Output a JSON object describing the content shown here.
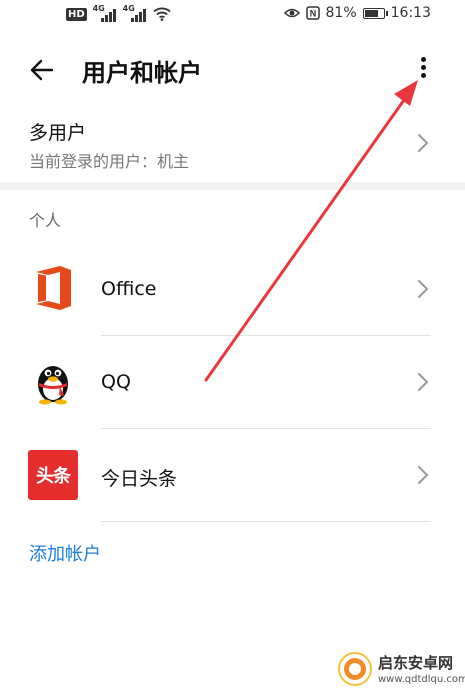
{
  "status_bar": {
    "hd_label": "HD",
    "network_1": "4G",
    "network_2": "4G",
    "nfc_label": "N",
    "battery_percent": "81%",
    "battery_level": 0.81,
    "time": "16:13"
  },
  "header": {
    "title": "用户和帐户"
  },
  "multi_user": {
    "title": "多用户",
    "subtitle": "当前登录的用户：机主"
  },
  "personal_section": {
    "label": "个人",
    "accounts": [
      {
        "name": "Office",
        "icon": "office-icon"
      },
      {
        "name": "QQ",
        "icon": "qq-penguin-icon"
      },
      {
        "name": "今日头条",
        "icon": "toutiao-icon",
        "icon_text": "头条"
      }
    ]
  },
  "add_account": {
    "label": "添加帐户"
  },
  "watermark": {
    "title": "启东安卓网",
    "url": "www.qdtdlqu.com"
  },
  "colors": {
    "accent": "#1a7fd9",
    "office": "#e64a19",
    "toutiao": "#e52d2e",
    "arrow": "#e8383d"
  }
}
